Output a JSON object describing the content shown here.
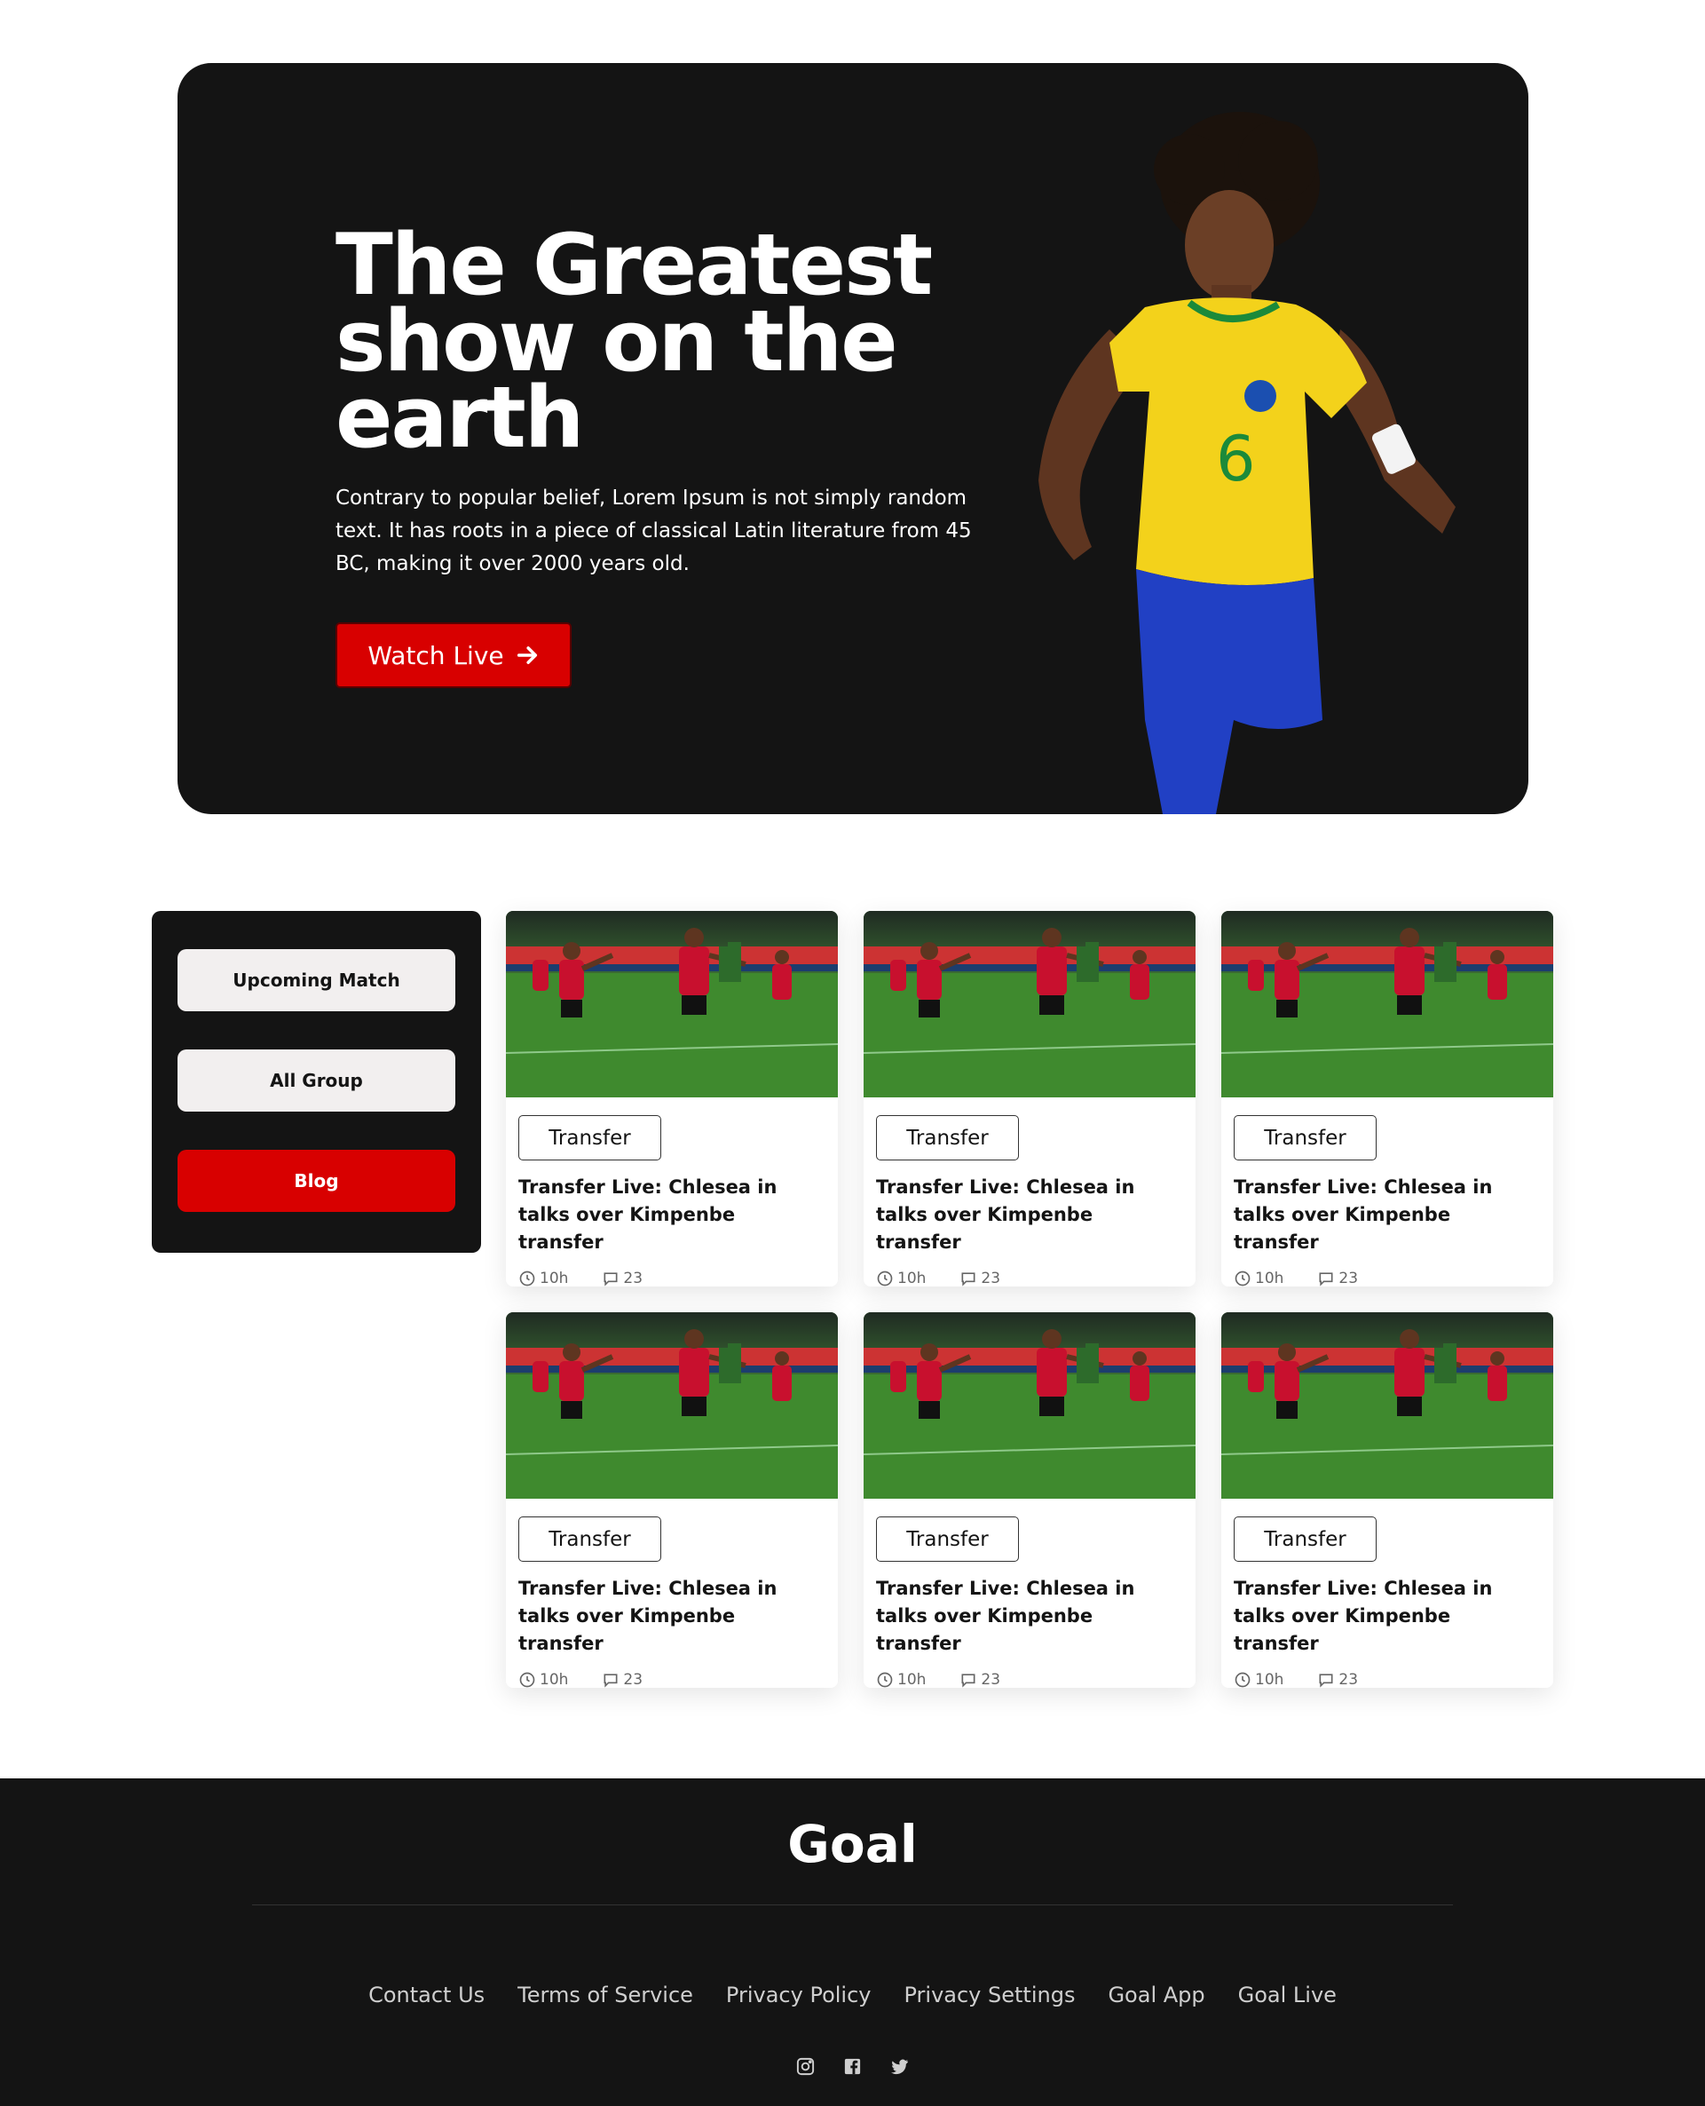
{
  "hero": {
    "title": "The Greatest show on the earth",
    "description": "Contrary to popular belief, Lorem Ipsum is not simply random text. It has roots in a piece of classical Latin literature from 45 BC, making it over 2000 years old.",
    "button_label": "Watch Live",
    "accent": "#d80000"
  },
  "sidebar": {
    "items": [
      {
        "label": "Upcoming Match",
        "active": false
      },
      {
        "label": "All Group",
        "active": false
      },
      {
        "label": "Blog",
        "active": true
      }
    ]
  },
  "cards": [
    {
      "tag": "Transfer",
      "title": "Transfer Live: Chlesea in talks over Kimpenbe transfer",
      "time": "10h",
      "comments": "23"
    },
    {
      "tag": "Transfer",
      "title": "Transfer Live: Chlesea in talks over Kimpenbe transfer",
      "time": "10h",
      "comments": "23"
    },
    {
      "tag": "Transfer",
      "title": "Transfer Live: Chlesea in talks over Kimpenbe transfer",
      "time": "10h",
      "comments": "23"
    },
    {
      "tag": "Transfer",
      "title": "Transfer Live: Chlesea in talks over Kimpenbe transfer",
      "time": "10h",
      "comments": "23"
    },
    {
      "tag": "Transfer",
      "title": "Transfer Live: Chlesea in talks over Kimpenbe transfer",
      "time": "10h",
      "comments": "23"
    },
    {
      "tag": "Transfer",
      "title": "Transfer Live: Chlesea in talks over Kimpenbe transfer",
      "time": "10h",
      "comments": "23"
    }
  ],
  "footer": {
    "logo": "Goal",
    "links": [
      "Contact Us",
      "Terms of Service",
      "Privacy Policy",
      "Privacy Settings",
      "Goal App",
      "Goal Live"
    ],
    "socials": [
      "instagram-icon",
      "facebook-icon",
      "twitter-icon"
    ]
  }
}
